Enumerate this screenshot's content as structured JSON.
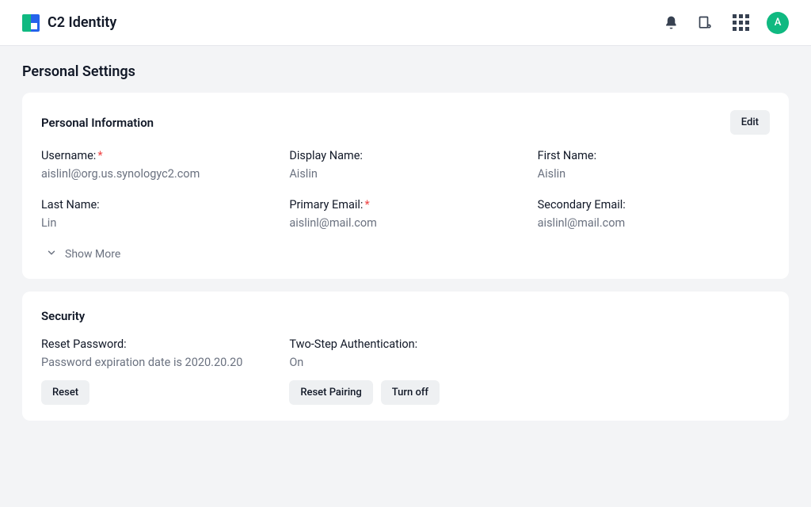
{
  "header": {
    "app_title": "C2 Identity",
    "avatar_initial": "A"
  },
  "page": {
    "title": "Personal Settings"
  },
  "personal_info": {
    "title": "Personal Information",
    "edit_label": "Edit",
    "fields": {
      "username": {
        "label": "Username:",
        "value": "aislinl@org.us.synologyc2.com",
        "required": true
      },
      "display_name": {
        "label": "Display Name:",
        "value": "Aislin",
        "required": false
      },
      "first_name": {
        "label": "First Name:",
        "value": "Aislin",
        "required": false
      },
      "last_name": {
        "label": "Last Name:",
        "value": "Lin",
        "required": false
      },
      "primary_email": {
        "label": "Primary Email:",
        "value": "aislinl@mail.com",
        "required": true
      },
      "secondary_email": {
        "label": "Secondary Email:",
        "value": "aislinl@mail.com",
        "required": false
      }
    },
    "show_more_label": "Show More"
  },
  "security": {
    "title": "Security",
    "reset_password": {
      "label": "Reset Password:",
      "value": "Password expiration date is 2020.20.20",
      "button": "Reset"
    },
    "two_step": {
      "label": "Two-Step Authentication:",
      "value": "On",
      "reset_pairing_button": "Reset Pairing",
      "turn_off_button": "Turn off"
    }
  }
}
